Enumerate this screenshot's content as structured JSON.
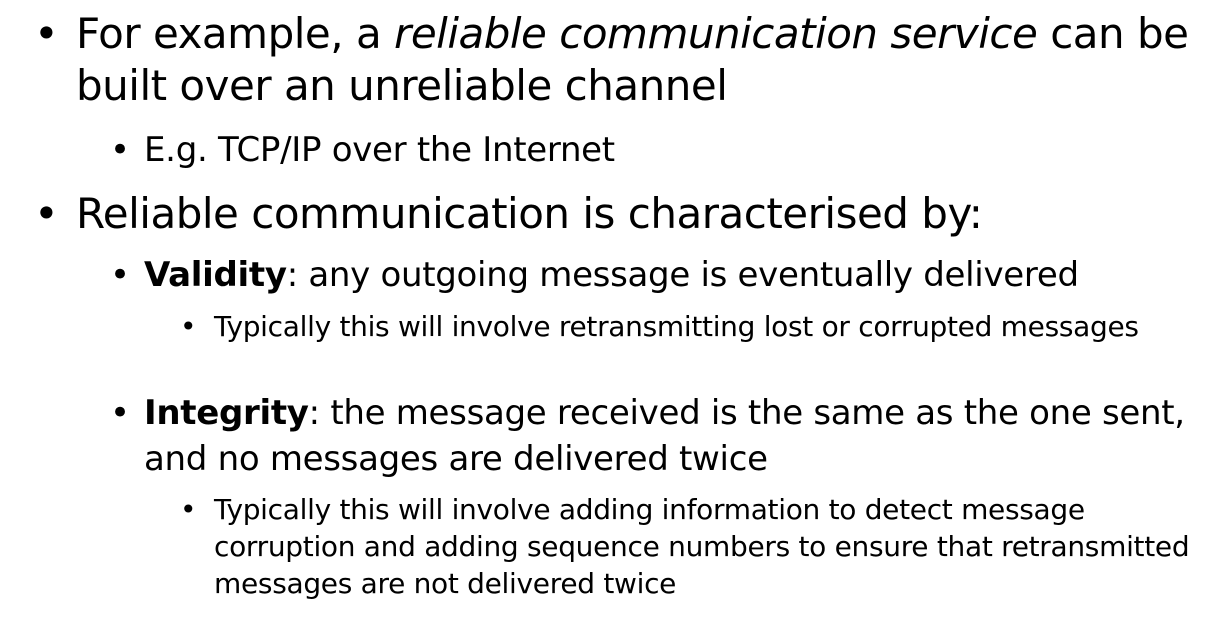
{
  "bullet_glyph": "•",
  "bullets": [
    {
      "before": "For example, a ",
      "emphasis": "reliable communication service",
      "after": " can be built over an unreliable channel"
    },
    {
      "text": "E.g. TCP/IP over the Internet"
    },
    {
      "text": "Reliable communication is characterised by:"
    },
    {
      "term": "Validity",
      "rest": ": any outgoing message is eventually delivered"
    },
    {
      "text": "Typically this will involve retransmitting lost or corrupted messages"
    },
    {
      "term": "Integrity",
      "rest": ": the message received is the same as the one sent, and no messages are delivered twice"
    },
    {
      "text": "Typically this will involve adding information to detect message corruption and adding sequence numbers to ensure that retransmitted messages are not delivered twice"
    }
  ]
}
